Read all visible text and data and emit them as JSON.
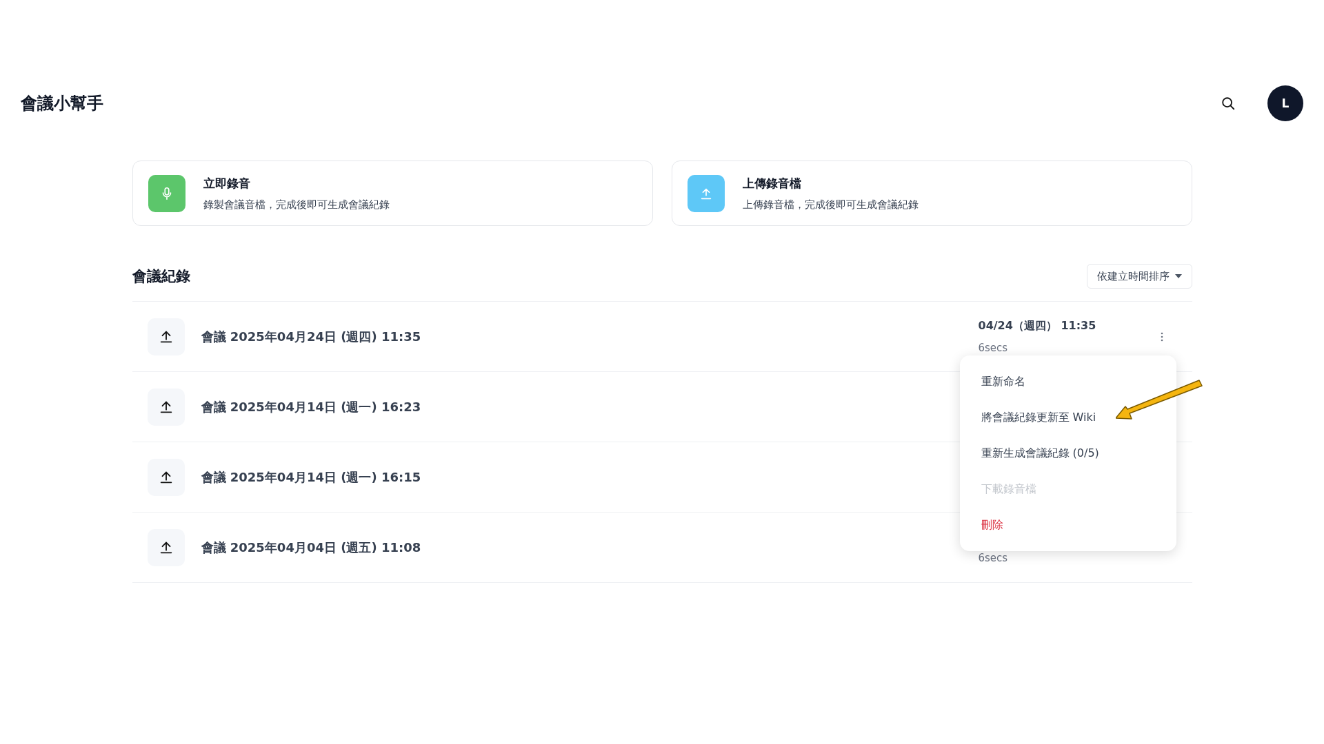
{
  "header": {
    "title": "會議小幫手",
    "avatar": "L"
  },
  "actions": [
    {
      "kind": "record",
      "title": "立即錄音",
      "description": "錄製會議音檔，完成後即可生成會議紀錄"
    },
    {
      "kind": "upload",
      "title": "上傳錄音檔",
      "description": "上傳錄音檔，完成後即可生成會議紀錄"
    }
  ],
  "records": {
    "title": "會議紀錄",
    "sort": "依建立時間排序",
    "rows": [
      {
        "title": "會議 2025年04月24日 (週四) 11:35",
        "date": "04/24（週四） 11:35",
        "duration": "6secs",
        "menu_open": true
      },
      {
        "title": "會議 2025年04月14日 (週一) 16:23",
        "menu_open": false
      },
      {
        "title": "會議 2025年04月14日 (週一) 16:15",
        "menu_open": false
      },
      {
        "title": "會議 2025年04月04日 (週五) 11:08",
        "duration": "6secs",
        "menu_open": false
      }
    ]
  },
  "menu": [
    {
      "label": "重新命名",
      "kind": "normal",
      "disabled": false
    },
    {
      "label": "將會議紀錄更新至 Wiki",
      "kind": "normal",
      "disabled": false
    },
    {
      "label": "重新生成會議紀錄 (0/5)",
      "kind": "normal",
      "disabled": false
    },
    {
      "label": "下載錄音檔",
      "kind": "normal",
      "disabled": true
    },
    {
      "label": "刪除",
      "kind": "danger",
      "disabled": false
    }
  ]
}
